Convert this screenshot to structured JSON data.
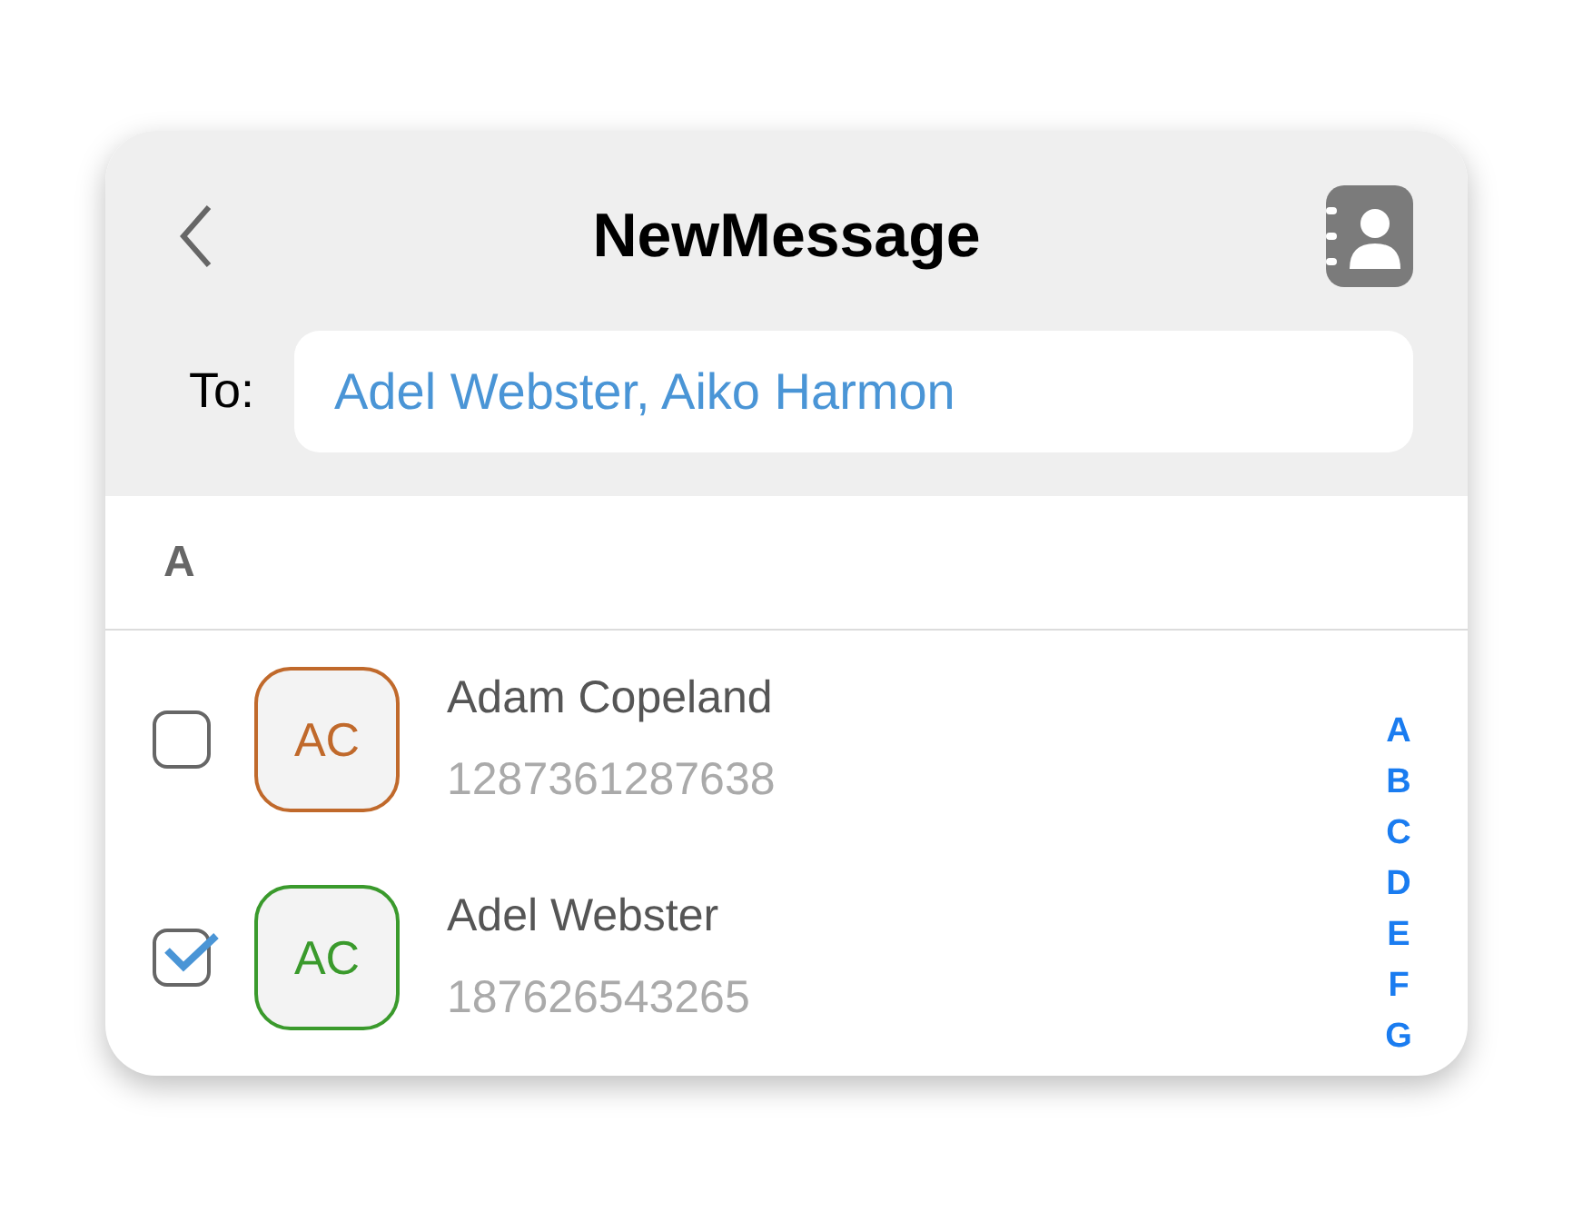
{
  "header": {
    "title": "NewMessage"
  },
  "to": {
    "label": "To:",
    "value": "Adel Webster, Aiko Harmon"
  },
  "section": {
    "letter": "A"
  },
  "contacts": [
    {
      "name": "Adam Copeland",
      "phone": "1287361287638",
      "initials": "AC",
      "color": "#c0692b",
      "checked": false
    },
    {
      "name": "Adel Webster",
      "phone": "187626543265",
      "initials": "AC",
      "color": "#3a9a2c",
      "checked": true
    }
  ],
  "index": [
    "A",
    "B",
    "C",
    "D",
    "E",
    "F",
    "G"
  ]
}
